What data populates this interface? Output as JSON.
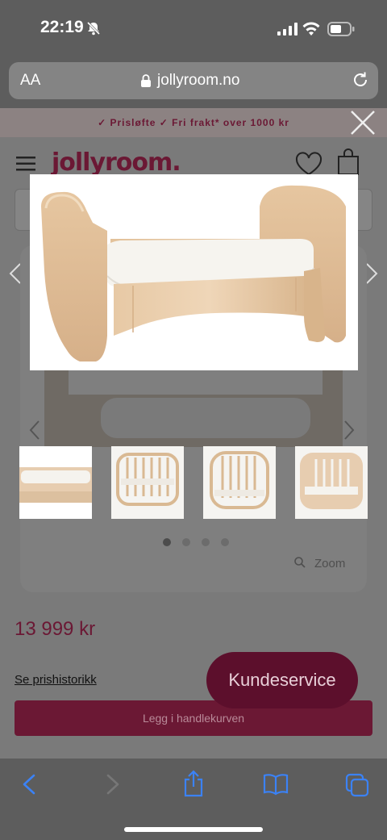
{
  "status": {
    "time": "22:19",
    "icons": [
      "bell-slash-icon",
      "signal-icon",
      "wifi-icon",
      "battery-icon"
    ]
  },
  "browser": {
    "text_size_label": "AA",
    "url": "jollyroom.no"
  },
  "site": {
    "promo": "✓ Prisløfte   ✓ Fri frakt* over 1000 kr",
    "logo": "jollyroom."
  },
  "product": {
    "price": "13 999 kr",
    "price_history_link": "Se prishistorikk",
    "add_to_cart": "Legg i handlekurven",
    "zoom_label": "Zoom",
    "gallery_dots": 4,
    "gallery_active_dot": 0
  },
  "support": {
    "label": "Kundeservice"
  },
  "colors": {
    "brand": "#6b1834",
    "overlay_bg": "#7a7a7a",
    "browser_chrome": "#5d5d5d",
    "toolbar_icons": "#3b82f6"
  }
}
